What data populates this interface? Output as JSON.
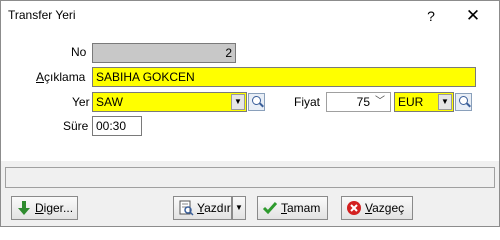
{
  "window": {
    "title": "Transfer Yeri",
    "help_glyph": "?",
    "close_glyph": "✕"
  },
  "form": {
    "no_label": "No",
    "no_value": "2",
    "aciklama_label_first": "A",
    "aciklama_label_rest": "çıklama",
    "aciklama_value": "SABIHA GOKCEN",
    "yer_label": "Yer",
    "yer_value": "SAW",
    "fiyat_label": "Fiyat",
    "fiyat_value": "75",
    "currency_value": "EUR",
    "sure_label": "Süre",
    "sure_value": "00:30"
  },
  "buttons": {
    "diger": {
      "first": "D",
      "rest": "iger..."
    },
    "yazdir": {
      "first": "Y",
      "rest": "azdır"
    },
    "tamam": {
      "first": "T",
      "rest": "amam"
    },
    "vazgec": {
      "first": "V",
      "rest": "azgeç"
    }
  },
  "icons": {
    "diger": "down-arrow-icon",
    "yazdir": "print-preview-icon",
    "tamam": "checkmark-icon",
    "vazgec": "cancel-icon",
    "lookup": "magnifier-icon"
  },
  "colors": {
    "required_field": "#ffff00",
    "readonly_field": "#c8c8c8"
  }
}
